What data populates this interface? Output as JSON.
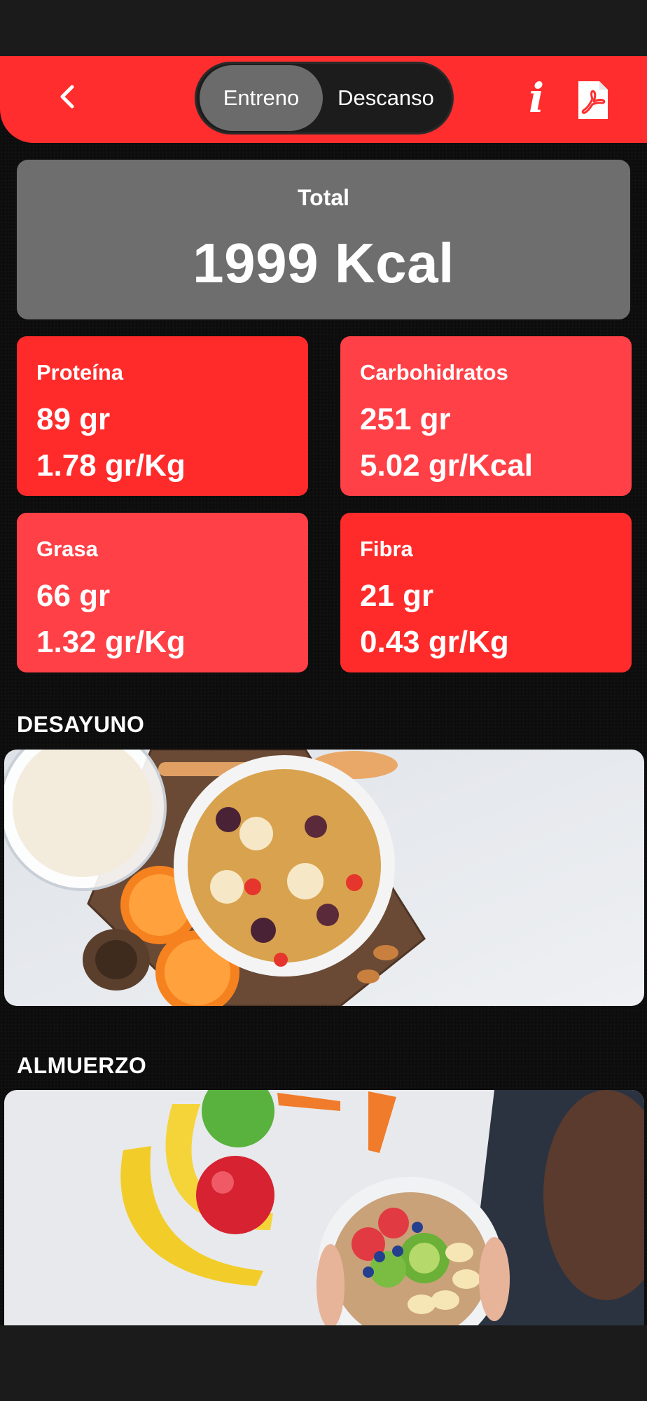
{
  "header": {
    "tabs": [
      {
        "label": "Entreno",
        "active": true
      },
      {
        "label": "Descanso",
        "active": false
      }
    ],
    "back_icon": "chevron-left-icon",
    "info_icon": "info-icon",
    "info_glyph": "i",
    "pdf_icon": "pdf-icon",
    "accent_color": "#ff2d2d"
  },
  "total": {
    "label": "Total",
    "value": "1999 Kcal"
  },
  "macros": [
    {
      "name": "Proteína",
      "amount": "89 gr",
      "ratio": "1.78 gr/Kg"
    },
    {
      "name": "Carbohidratos",
      "amount": "251 gr",
      "ratio": "5.02 gr/Kcal"
    },
    {
      "name": "Grasa",
      "amount": "66 gr",
      "ratio": "1.32 gr/Kg"
    },
    {
      "name": "Fibra",
      "amount": "21 gr",
      "ratio": "0.43 gr/Kg"
    }
  ],
  "meals": [
    {
      "title": "DESAYUNO",
      "image": "breakfast-cereal-photo"
    },
    {
      "title": "ALMUERZO",
      "image": "fruit-bowl-photo"
    }
  ]
}
